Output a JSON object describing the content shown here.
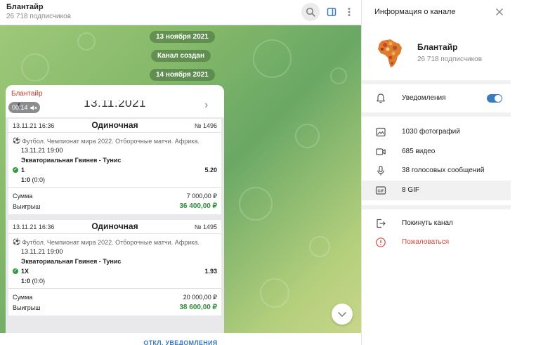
{
  "chat": {
    "title": "Блантайр",
    "subtitle": "26 718 подписчиков",
    "dates": [
      "13 ноября 2021",
      "Канал создан",
      "14 ноября 2021"
    ],
    "message": {
      "author": "Блантайр",
      "video_time": "00:14",
      "screenshot_date": "13.11.2021",
      "tickets": [
        {
          "datetime": "13.11.21 16:36",
          "type": "Одиночная",
          "number": "№ 1496",
          "sport": "Футбол. Чемпионат мира 2022. Отборочные матчи. Африка.",
          "match_time": "13.11.21 19:00",
          "match": "Экваториальная Гвинея - Тунис",
          "pick": "1",
          "odds": "5.20",
          "score_main": "1:0",
          "score_extra": "(0:0)",
          "sum_label": "Сумма",
          "sum_value": "7 000,00 ₽",
          "win_label": "Выигрыш",
          "win_value": "36 400,00 ₽"
        },
        {
          "datetime": "13.11.21 16:36",
          "type": "Одиночная",
          "number": "№ 1495",
          "sport": "Футбол. Чемпионат мира 2022. Отборочные матчи. Африка.",
          "match_time": "13.11.21 19:00",
          "match": "Экваториальная Гвинея - Тунис",
          "pick": "1X",
          "odds": "1.93",
          "score_main": "1:0",
          "score_extra": "(0:0)",
          "sum_label": "Сумма",
          "sum_value": "20 000,00 ₽",
          "win_label": "Выигрыш",
          "win_value": "38 600,00 ₽"
        }
      ]
    },
    "footer_action": "ОТКЛ. УВЕДОМЛЕНИЯ"
  },
  "info": {
    "title": "Информация о канале",
    "channel_name": "Блантайр",
    "subscribers": "26 718 подписчиков",
    "notifications_label": "Уведомления",
    "notifications_on": true,
    "media": {
      "photos": "1030 фотографий",
      "videos": "685 видео",
      "voice": "38 голосовых сообщений",
      "gif": "8 GIF"
    },
    "leave": "Покинуть канал",
    "report": "Пожаловаться"
  },
  "colors": {
    "accent": "#3a7bbf",
    "author": "#c0392b",
    "win": "#2e8b3a",
    "danger": "#d04b3d"
  }
}
